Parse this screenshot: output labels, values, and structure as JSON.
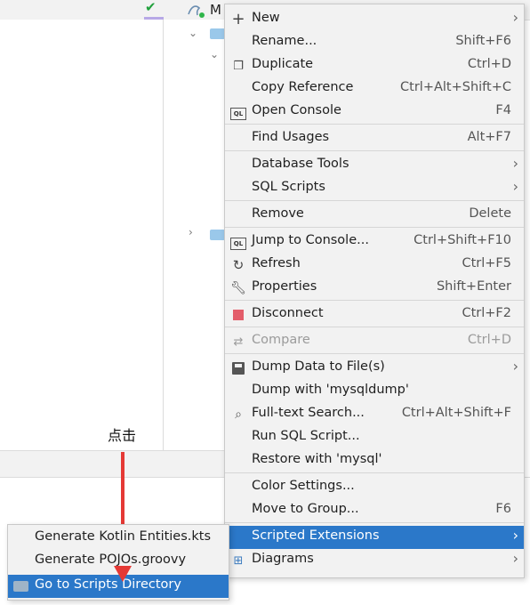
{
  "header": {
    "db_label": "M"
  },
  "annotation": {
    "callout": "点击"
  },
  "context_menu": {
    "items": [
      {
        "label": "New",
        "shortcut": "",
        "submenu": true,
        "icon": "plus-icon"
      },
      {
        "label": "Rename...",
        "shortcut": "Shift+F6",
        "icon": ""
      },
      {
        "label": "Duplicate",
        "shortcut": "Ctrl+D",
        "icon": "duplicate-icon"
      },
      {
        "label": "Copy Reference",
        "shortcut": "Ctrl+Alt+Shift+C",
        "icon": ""
      },
      {
        "label": "Open Console",
        "shortcut": "F4",
        "icon": "console-icon"
      },
      {
        "label": "Find Usages",
        "shortcut": "Alt+F7",
        "icon": ""
      },
      {
        "label": "Database Tools",
        "shortcut": "",
        "submenu": true,
        "icon": ""
      },
      {
        "label": "SQL Scripts",
        "shortcut": "",
        "submenu": true,
        "icon": ""
      },
      {
        "label": "Remove",
        "shortcut": "Delete",
        "icon": ""
      },
      {
        "label": "Jump to Console...",
        "shortcut": "Ctrl+Shift+F10",
        "icon": "console-icon"
      },
      {
        "label": "Refresh",
        "shortcut": "Ctrl+F5",
        "icon": "refresh-icon"
      },
      {
        "label": "Properties",
        "shortcut": "Shift+Enter",
        "icon": "wrench-icon"
      },
      {
        "label": "Disconnect",
        "shortcut": "Ctrl+F2",
        "icon": "stop-icon"
      },
      {
        "label": "Compare",
        "shortcut": "Ctrl+D",
        "icon": "compare-icon",
        "disabled": true
      },
      {
        "label": "Dump Data to File(s)",
        "shortcut": "",
        "submenu": true,
        "icon": "save-icon"
      },
      {
        "label": "Dump with 'mysqldump'",
        "shortcut": "",
        "icon": ""
      },
      {
        "label": "Full-text Search...",
        "shortcut": "Ctrl+Alt+Shift+F",
        "icon": "search-icon"
      },
      {
        "label": "Run SQL Script...",
        "shortcut": "",
        "icon": ""
      },
      {
        "label": "Restore with 'mysql'",
        "shortcut": "",
        "icon": ""
      },
      {
        "label": "Color Settings...",
        "shortcut": "",
        "icon": ""
      },
      {
        "label": "Move to Group...",
        "shortcut": "F6",
        "icon": ""
      },
      {
        "label": "Scripted Extensions",
        "shortcut": "",
        "submenu": true,
        "icon": "",
        "selected": true
      },
      {
        "label": "Diagrams",
        "shortcut": "",
        "submenu": true,
        "icon": "diagram-icon"
      }
    ]
  },
  "submenu": {
    "items": [
      {
        "label": "Generate Kotlin Entities.kts"
      },
      {
        "label": "Generate POJOs.groovy"
      },
      {
        "label": "Go to Scripts Directory",
        "selected": true
      }
    ]
  },
  "colors": {
    "selection": "#2b78c9",
    "menu_bg": "#f2f2f2",
    "arrow": "#e53935"
  }
}
